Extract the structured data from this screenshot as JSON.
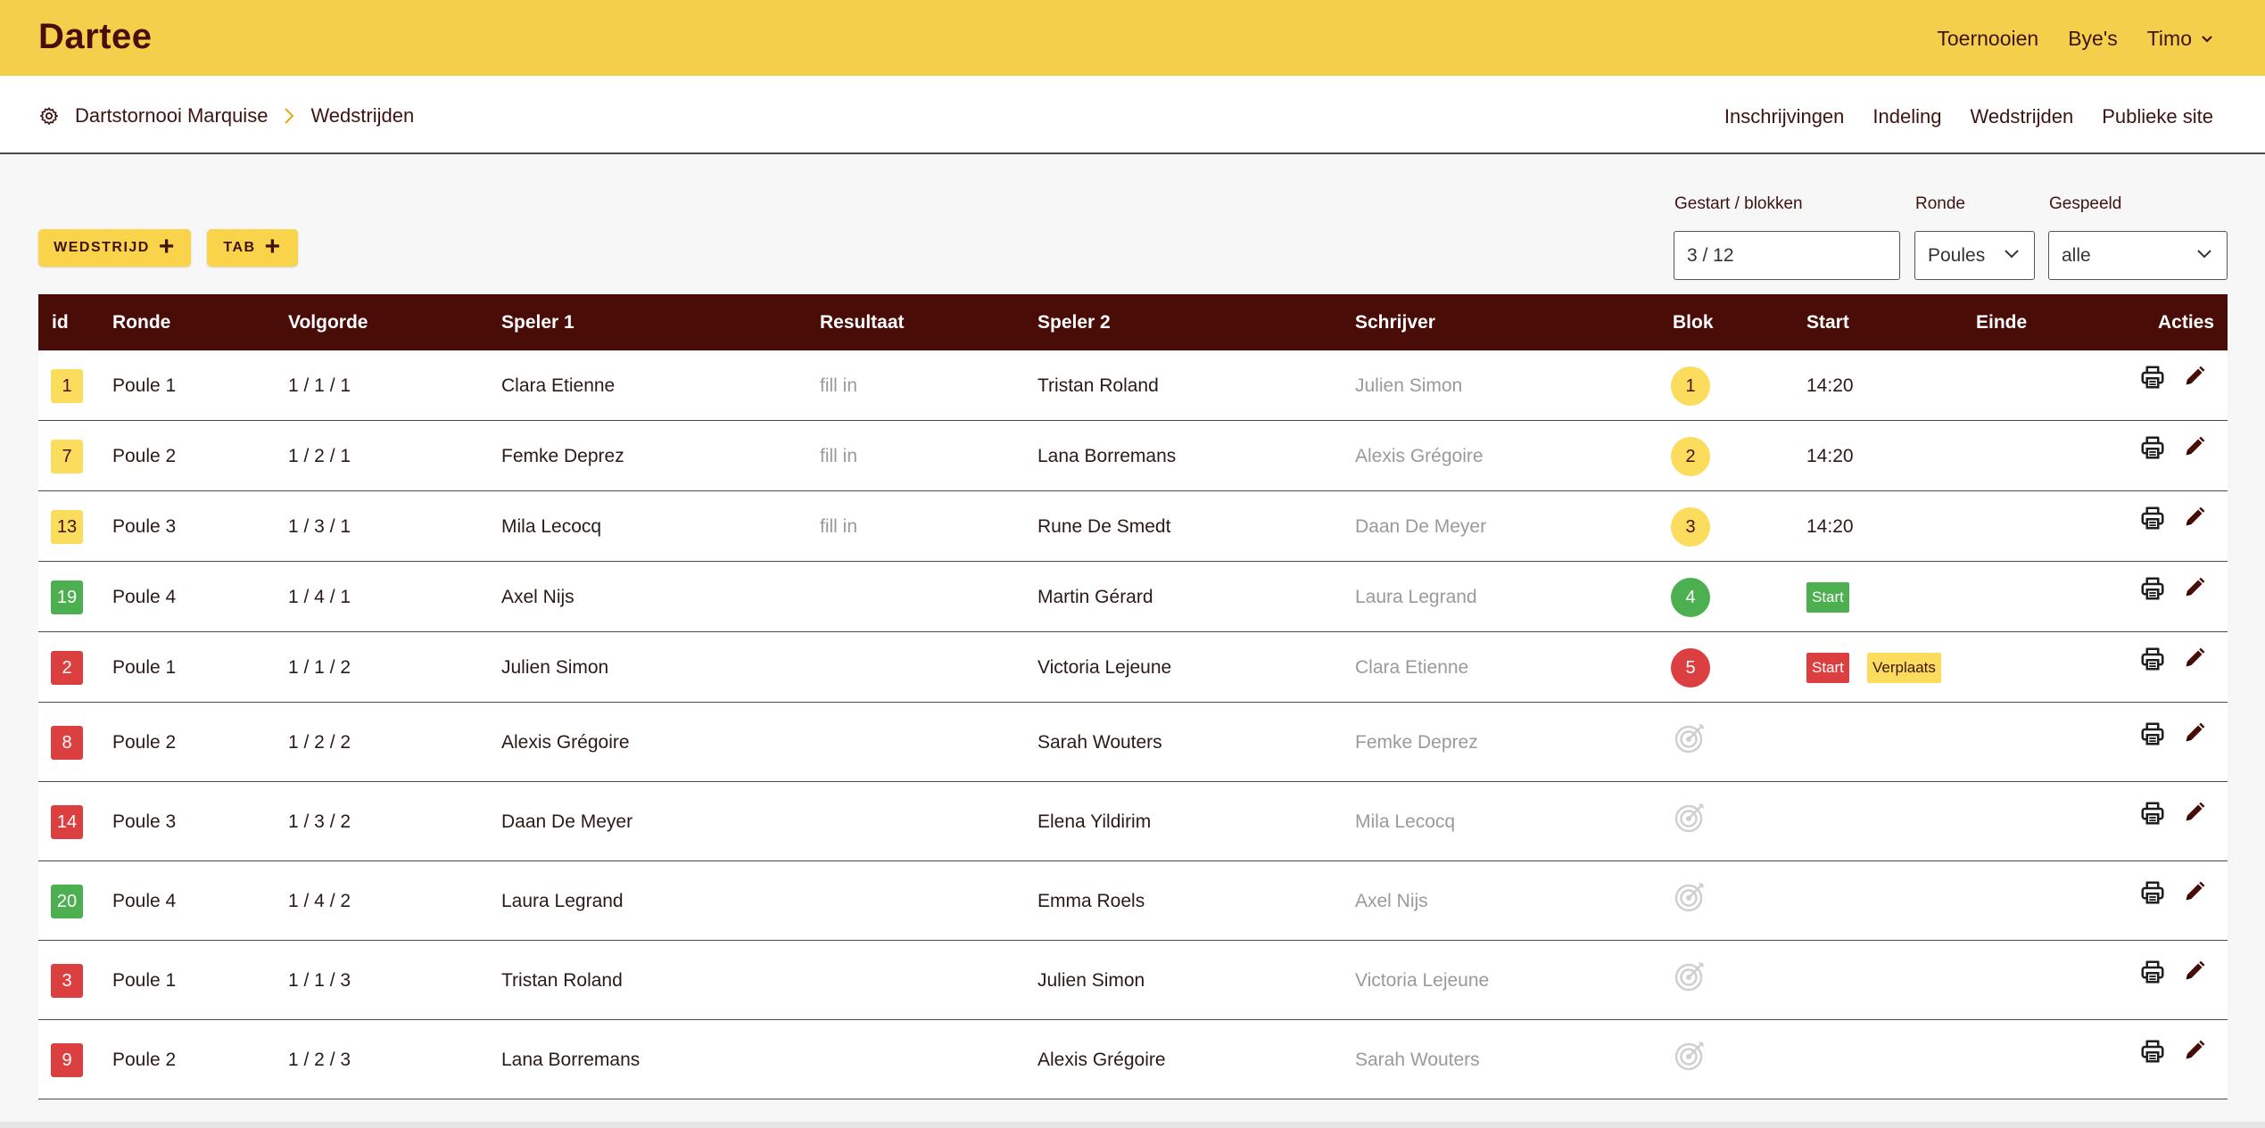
{
  "app": {
    "brand": "Dartee"
  },
  "topnav": {
    "tournaments": "Toernooien",
    "byes": "Bye's",
    "user": "Timo"
  },
  "breadcrumb": {
    "tournament": "Dartstornooi Marquise",
    "current": "Wedstrijden"
  },
  "subnav": [
    "Inschrijvingen",
    "Indeling",
    "Wedstrijden",
    "Publieke site"
  ],
  "actions": {
    "add_match": "WEDSTRIJD",
    "add_tab": "TAB"
  },
  "filters": {
    "started_label": "Gestart / blokken",
    "started_value": "3 / 12",
    "round_label": "Ronde",
    "round_value": "Poules",
    "played_label": "Gespeeld",
    "played_value": "alle"
  },
  "table": {
    "headers": {
      "id": "id",
      "ronde": "Ronde",
      "volgorde": "Volgorde",
      "speler1": "Speler 1",
      "resultaat": "Resultaat",
      "speler2": "Speler 2",
      "schrijver": "Schrijver",
      "blok": "Blok",
      "start": "Start",
      "einde": "Einde",
      "acties": "Acties"
    },
    "rows": [
      {
        "id": "1",
        "id_status": "yellow",
        "ronde": "Poule 1",
        "volgorde": "1 / 1 / 1",
        "speler1": "Clara Etienne",
        "resultaat": "fill in",
        "speler2": "Tristan Roland",
        "schrijver": "Julien Simon",
        "blok": "1",
        "blok_status": "yellow",
        "start": "14:20"
      },
      {
        "id": "7",
        "id_status": "yellow",
        "ronde": "Poule 2",
        "volgorde": "1 / 2 / 1",
        "speler1": "Femke Deprez",
        "resultaat": "fill in",
        "speler2": "Lana Borremans",
        "schrijver": "Alexis Grégoire",
        "blok": "2",
        "blok_status": "yellow",
        "start": "14:20"
      },
      {
        "id": "13",
        "id_status": "yellow",
        "ronde": "Poule 3",
        "volgorde": "1 / 3 / 1",
        "speler1": "Mila Lecocq",
        "resultaat": "fill in",
        "speler2": "Rune De Smedt",
        "schrijver": "Daan De Meyer",
        "blok": "3",
        "blok_status": "yellow",
        "start": "14:20"
      },
      {
        "id": "19",
        "id_status": "green",
        "ronde": "Poule 4",
        "volgorde": "1 / 4 / 1",
        "speler1": "Axel Nijs",
        "resultaat": "",
        "speler2": "Martin Gérard",
        "schrijver": "Laura Legrand",
        "blok": "4",
        "blok_status": "green",
        "start_button": "Start"
      },
      {
        "id": "2",
        "id_status": "red",
        "ronde": "Poule 1",
        "volgorde": "1 / 1 / 2",
        "speler1": "Julien Simon",
        "resultaat": "",
        "speler2": "Victoria Lejeune",
        "schrijver": "Clara Etienne",
        "blok": "5",
        "blok_status": "red",
        "start_button": "Start",
        "move_button": "Verplaats"
      },
      {
        "id": "8",
        "id_status": "red",
        "ronde": "Poule 2",
        "volgorde": "1 / 2 / 2",
        "speler1": "Alexis Grégoire",
        "resultaat": "",
        "speler2": "Sarah Wouters",
        "schrijver": "Femke Deprez",
        "blok_icon": "dartboard-icon"
      },
      {
        "id": "14",
        "id_status": "red",
        "ronde": "Poule 3",
        "volgorde": "1 / 3 / 2",
        "speler1": "Daan De Meyer",
        "resultaat": "",
        "speler2": "Elena Yildirim",
        "schrijver": "Mila Lecocq",
        "blok_icon": "dartboard-icon"
      },
      {
        "id": "20",
        "id_status": "green",
        "ronde": "Poule 4",
        "volgorde": "1 / 4 / 2",
        "speler1": "Laura Legrand",
        "resultaat": "",
        "speler2": "Emma Roels",
        "schrijver": "Axel Nijs",
        "blok_icon": "dartboard-icon"
      },
      {
        "id": "3",
        "id_status": "red",
        "ronde": "Poule 1",
        "volgorde": "1 / 1 / 3",
        "speler1": "Tristan Roland",
        "resultaat": "",
        "speler2": "Julien Simon",
        "schrijver": "Victoria Lejeune",
        "blok_icon": "dartboard-icon"
      },
      {
        "id": "9",
        "id_status": "red",
        "ronde": "Poule 2",
        "volgorde": "1 / 2 / 3",
        "speler1": "Lana Borremans",
        "resultaat": "",
        "speler2": "Alexis Grégoire",
        "schrijver": "Sarah Wouters",
        "blok_icon": "dartboard-icon"
      }
    ]
  },
  "colors": {
    "brand_yellow": "#f4cf4c",
    "header_dark": "#4a0c07",
    "yellow": "#fbdc5c",
    "green": "#4caf50",
    "red": "#dc3f3f"
  }
}
